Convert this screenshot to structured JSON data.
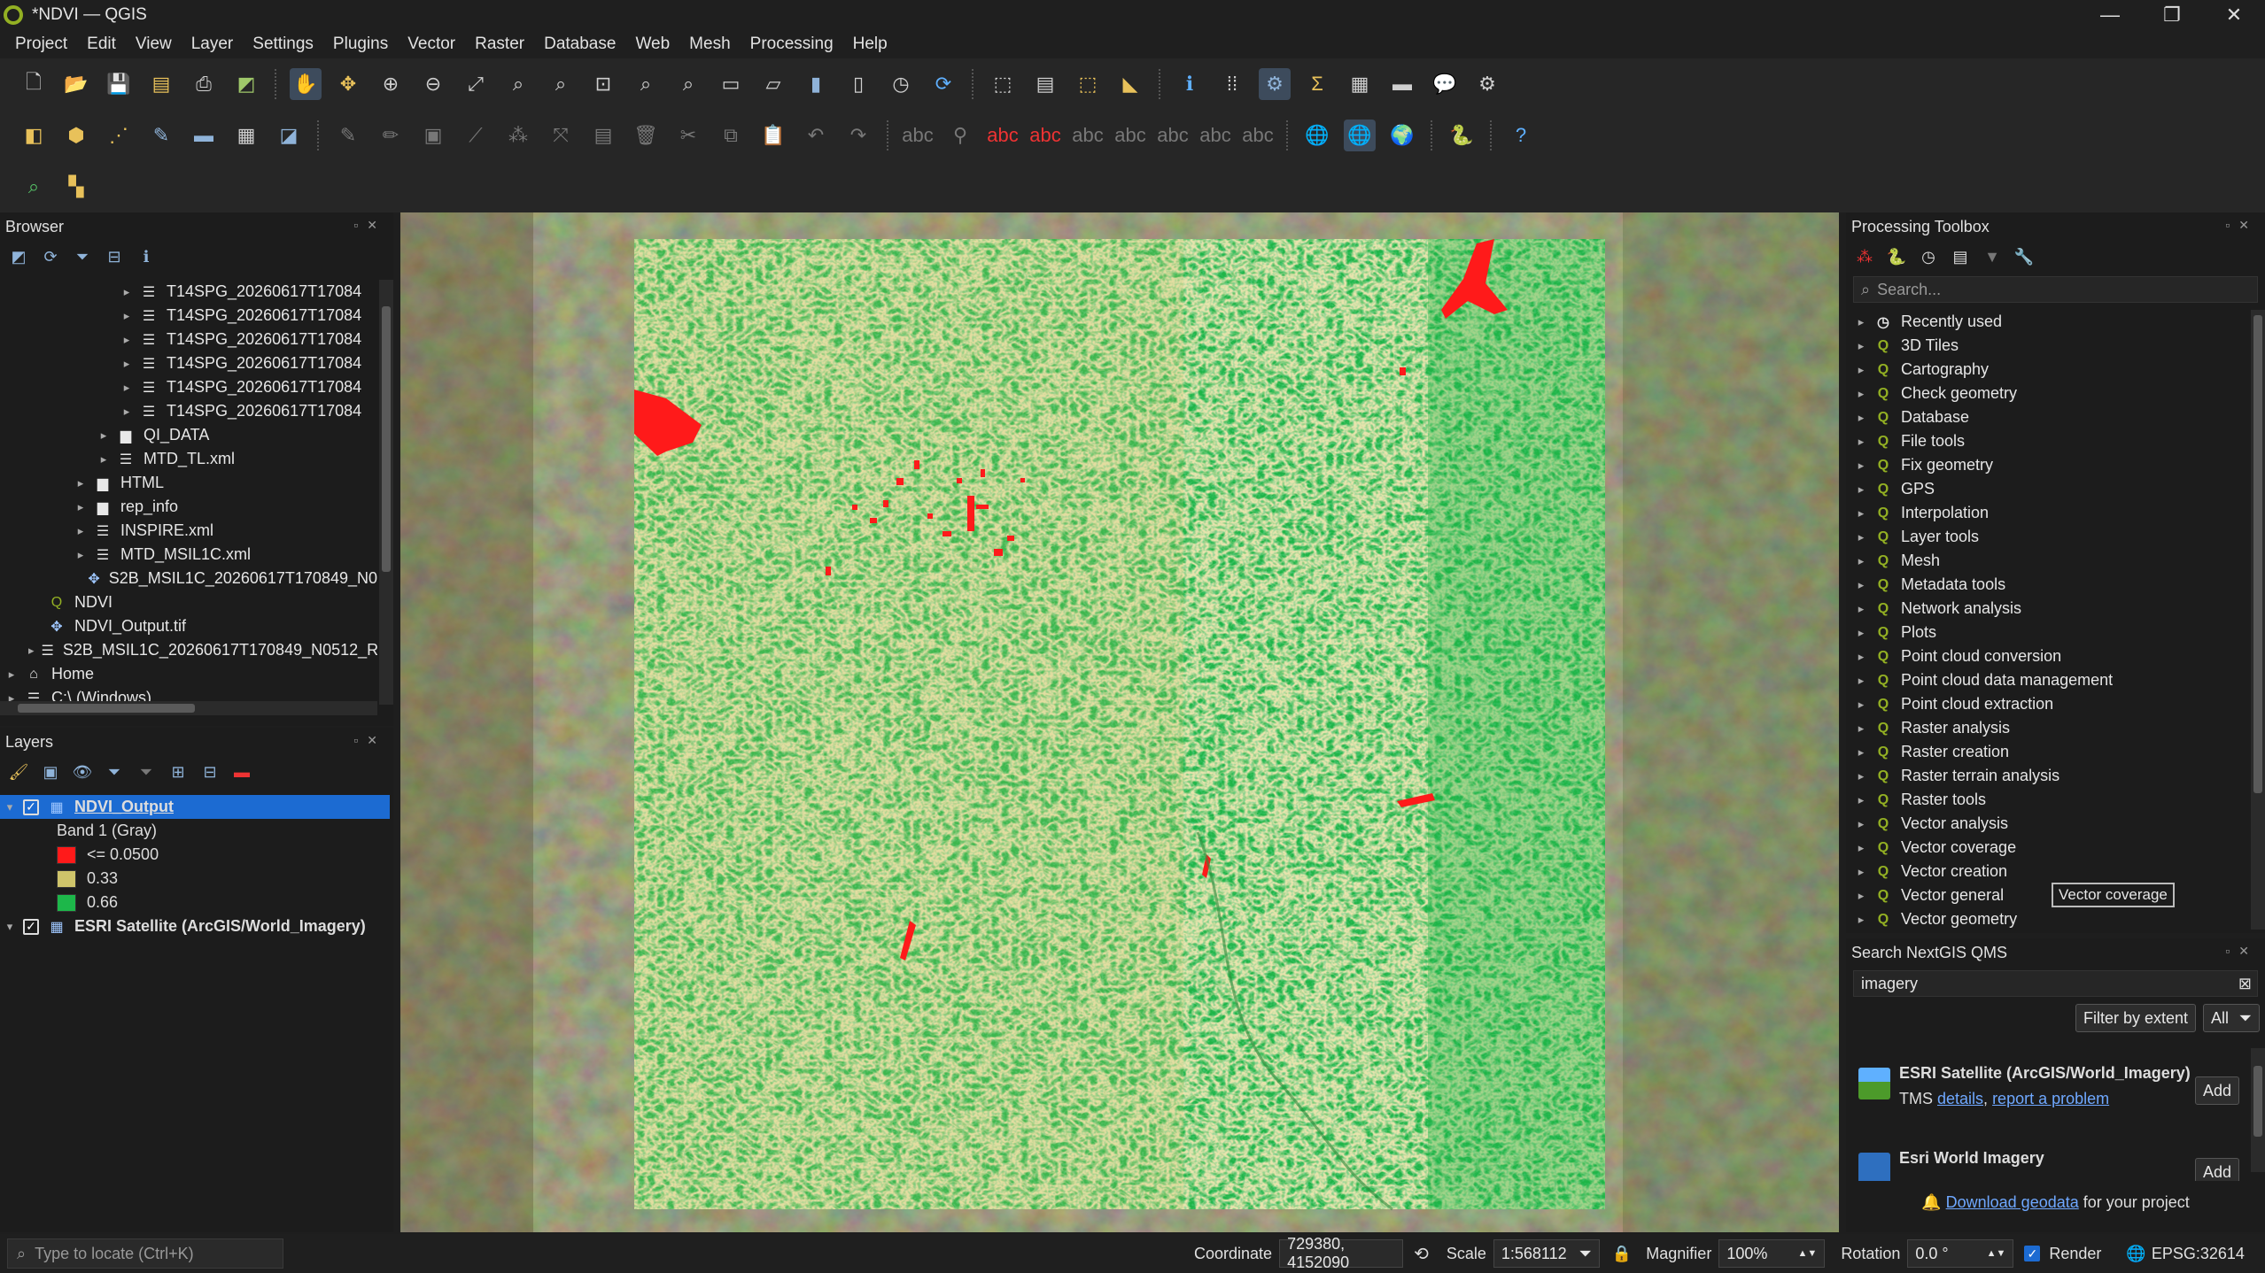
{
  "window": {
    "title": "*NDVI — QGIS",
    "min": "—",
    "max": "❐",
    "close": "✕"
  },
  "menu": [
    "Project",
    "Edit",
    "View",
    "Layer",
    "Settings",
    "Plugins",
    "Vector",
    "Raster",
    "Database",
    "Web",
    "Mesh",
    "Processing",
    "Help"
  ],
  "browser": {
    "title": "Browser",
    "items": [
      {
        "indent": 5,
        "arrow": "▸",
        "icon": "db",
        "label": "T14SPG_20260617T17084"
      },
      {
        "indent": 5,
        "arrow": "▸",
        "icon": "db",
        "label": "T14SPG_20260617T17084"
      },
      {
        "indent": 5,
        "arrow": "▸",
        "icon": "db",
        "label": "T14SPG_20260617T17084"
      },
      {
        "indent": 5,
        "arrow": "▸",
        "icon": "db",
        "label": "T14SPG_20260617T17084"
      },
      {
        "indent": 5,
        "arrow": "▸",
        "icon": "db",
        "label": "T14SPG_20260617T17084"
      },
      {
        "indent": 5,
        "arrow": "▸",
        "icon": "db",
        "label": "T14SPG_20260617T17084"
      },
      {
        "indent": 4,
        "arrow": "▸",
        "icon": "folder",
        "label": "QI_DATA"
      },
      {
        "indent": 4,
        "arrow": "▸",
        "icon": "db",
        "label": "MTD_TL.xml"
      },
      {
        "indent": 3,
        "arrow": "▸",
        "icon": "folder",
        "label": "HTML"
      },
      {
        "indent": 3,
        "arrow": "▸",
        "icon": "folder",
        "label": "rep_info"
      },
      {
        "indent": 3,
        "arrow": "▸",
        "icon": "db",
        "label": "INSPIRE.xml"
      },
      {
        "indent": 3,
        "arrow": "▸",
        "icon": "db",
        "label": "MTD_MSIL1C.xml"
      },
      {
        "indent": 3,
        "arrow": "",
        "icon": "grid",
        "label": "S2B_MSIL1C_20260617T170849_N0"
      },
      {
        "indent": 1,
        "arrow": "",
        "icon": "q",
        "label": "NDVI"
      },
      {
        "indent": 1,
        "arrow": "",
        "icon": "grid",
        "label": "NDVI_Output.tif"
      },
      {
        "indent": 1,
        "arrow": "▸",
        "icon": "db",
        "label": "S2B_MSIL1C_20260617T170849_N0512_R"
      },
      {
        "indent": 0,
        "arrow": "▸",
        "icon": "home",
        "label": "Home"
      },
      {
        "indent": 0,
        "arrow": "▸",
        "icon": "db",
        "label": "C:\\ (Windows)"
      }
    ]
  },
  "layers": {
    "title": "Layers",
    "ndvi": {
      "name": "NDVI_Output",
      "band": "Band 1 (Gray)",
      "legend": [
        {
          "color": "#ff1a1a",
          "label": "<= 0.0500"
        },
        {
          "color": "#cfc46a",
          "label": "0.33"
        },
        {
          "color": "#1db74a",
          "label": "0.66"
        }
      ]
    },
    "esri": {
      "name": "ESRI Satellite (ArcGIS/World_Imagery)"
    }
  },
  "toolbox": {
    "title": "Processing Toolbox",
    "search_placeholder": "Search...",
    "items": [
      "Recently used",
      "3D Tiles",
      "Cartography",
      "Check geometry",
      "Database",
      "File tools",
      "Fix geometry",
      "GPS",
      "Interpolation",
      "Layer tools",
      "Mesh",
      "Metadata tools",
      "Network analysis",
      "Plots",
      "Point cloud conversion",
      "Point cloud data management",
      "Point cloud extraction",
      "Raster analysis",
      "Raster creation",
      "Raster terrain analysis",
      "Raster tools",
      "Vector analysis",
      "Vector coverage",
      "Vector creation",
      "Vector general",
      "Vector geometry"
    ],
    "tooltip": "Vector coverage"
  },
  "qms": {
    "title": "Search NextGIS QMS",
    "query": "imagery",
    "filter_label": "Filter by extent",
    "all_label": "All",
    "results": [
      {
        "name": "ESRI Satellite (ArcGIS/World_Imagery)",
        "type": "TMS",
        "details": "details",
        "report": "report a problem",
        "add": "Add"
      },
      {
        "name": "Esri World Imagery",
        "add": "Add"
      }
    ],
    "download_link": "Download geodata",
    "download_rest": " for your project"
  },
  "status": {
    "locate_placeholder": "Type to locate (Ctrl+K)",
    "coord_label": "Coordinate",
    "coord": "729380, 4152090",
    "scale_label": "Scale",
    "scale": "1:568112",
    "magnifier_label": "Magnifier",
    "magnifier": "100%",
    "rotation_label": "Rotation",
    "rotation": "0.0 °",
    "render_label": "Render",
    "crs": "EPSG:32614"
  }
}
